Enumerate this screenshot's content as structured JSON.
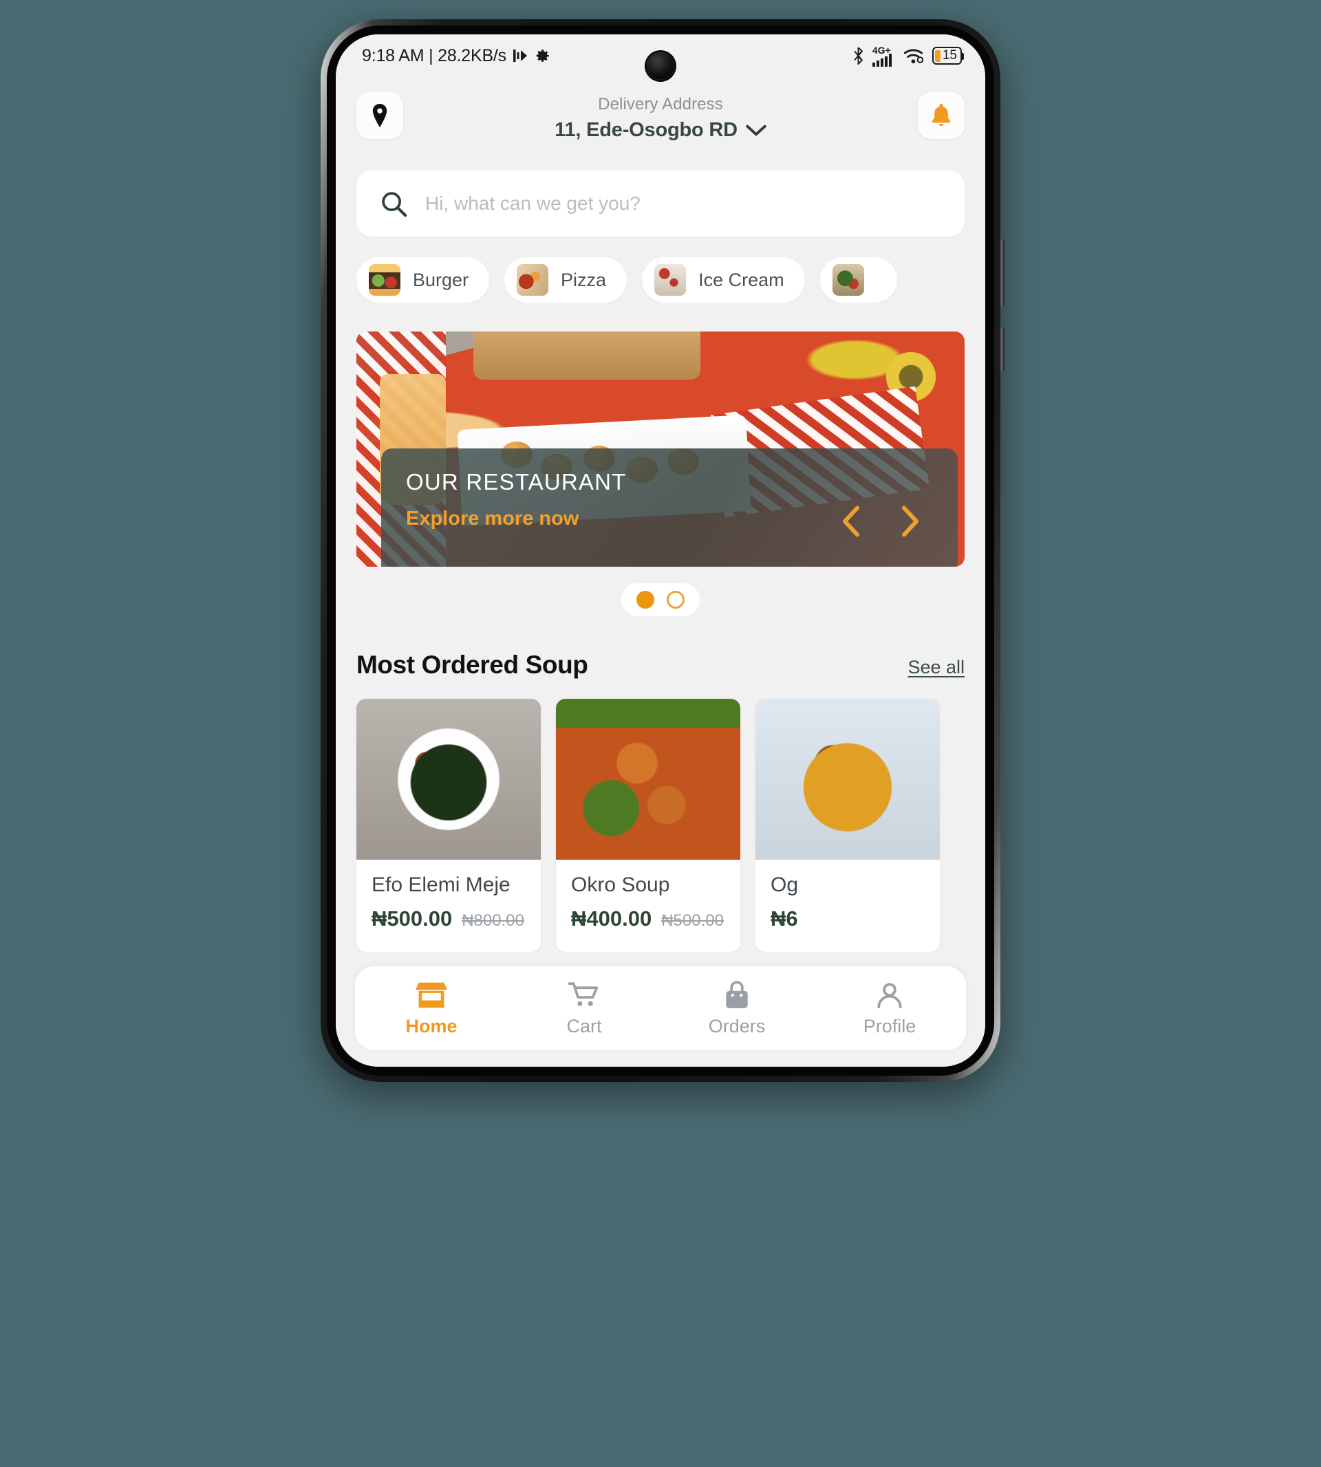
{
  "status_bar": {
    "time_and_data": "9:18 AM | 28.2KB/s",
    "network_type": "4G+",
    "battery_level": "15",
    "icons": [
      "data-transfer-icon",
      "gear-icon",
      "bluetooth-icon",
      "signal-bars-icon",
      "wifi-icon",
      "battery-icon"
    ]
  },
  "header": {
    "location_icon": "location-pin-icon",
    "address_label": "Delivery Address",
    "address_value": "11, Ede-Osogbo RD",
    "chevron": "chevron-down-icon",
    "notification_icon": "bell-icon"
  },
  "search": {
    "icon": "search-icon",
    "placeholder": "Hi, what can we get you?",
    "value": ""
  },
  "categories": [
    {
      "label": "Burger",
      "thumb": "burger-thumbnail"
    },
    {
      "label": "Pizza",
      "thumb": "pizza-thumbnail"
    },
    {
      "label": "Ice Cream",
      "thumb": "ice-cream-thumbnail"
    },
    {
      "label": "",
      "thumb": "vegetable-thumbnail"
    }
  ],
  "banner": {
    "title": "OUR RESTAURANT",
    "cta": "Explore more now",
    "prev_icon": "chevron-left-icon",
    "next_icon": "chevron-right-icon",
    "dots": {
      "total": 2,
      "active_index": 0
    }
  },
  "section": {
    "title": "Most Ordered Soup",
    "see_all": "See all"
  },
  "products": [
    {
      "name": "Efo Elemi Meje",
      "price": "₦500.00",
      "old_price": "₦800.00",
      "image": "efo-elemi-meje-image"
    },
    {
      "name": "Okro Soup",
      "price": "₦400.00",
      "old_price": "₦500.00",
      "image": "okro-soup-image"
    },
    {
      "name": "Og",
      "price": "₦6",
      "old_price": "",
      "image": "ogbono-soup-image"
    }
  ],
  "bottom_nav": [
    {
      "label": "Home",
      "icon": "storefront-icon",
      "active": true
    },
    {
      "label": "Cart",
      "icon": "shopping-cart-icon",
      "active": false
    },
    {
      "label": "Orders",
      "icon": "shopping-bag-icon",
      "active": false
    },
    {
      "label": "Profile",
      "icon": "person-icon",
      "active": false
    }
  ],
  "colors": {
    "accent_orange": "#f09a1e",
    "dark_green": "#2e4536",
    "page_bg": "#f1f1f1",
    "muted_gray": "#9aa0a5"
  }
}
